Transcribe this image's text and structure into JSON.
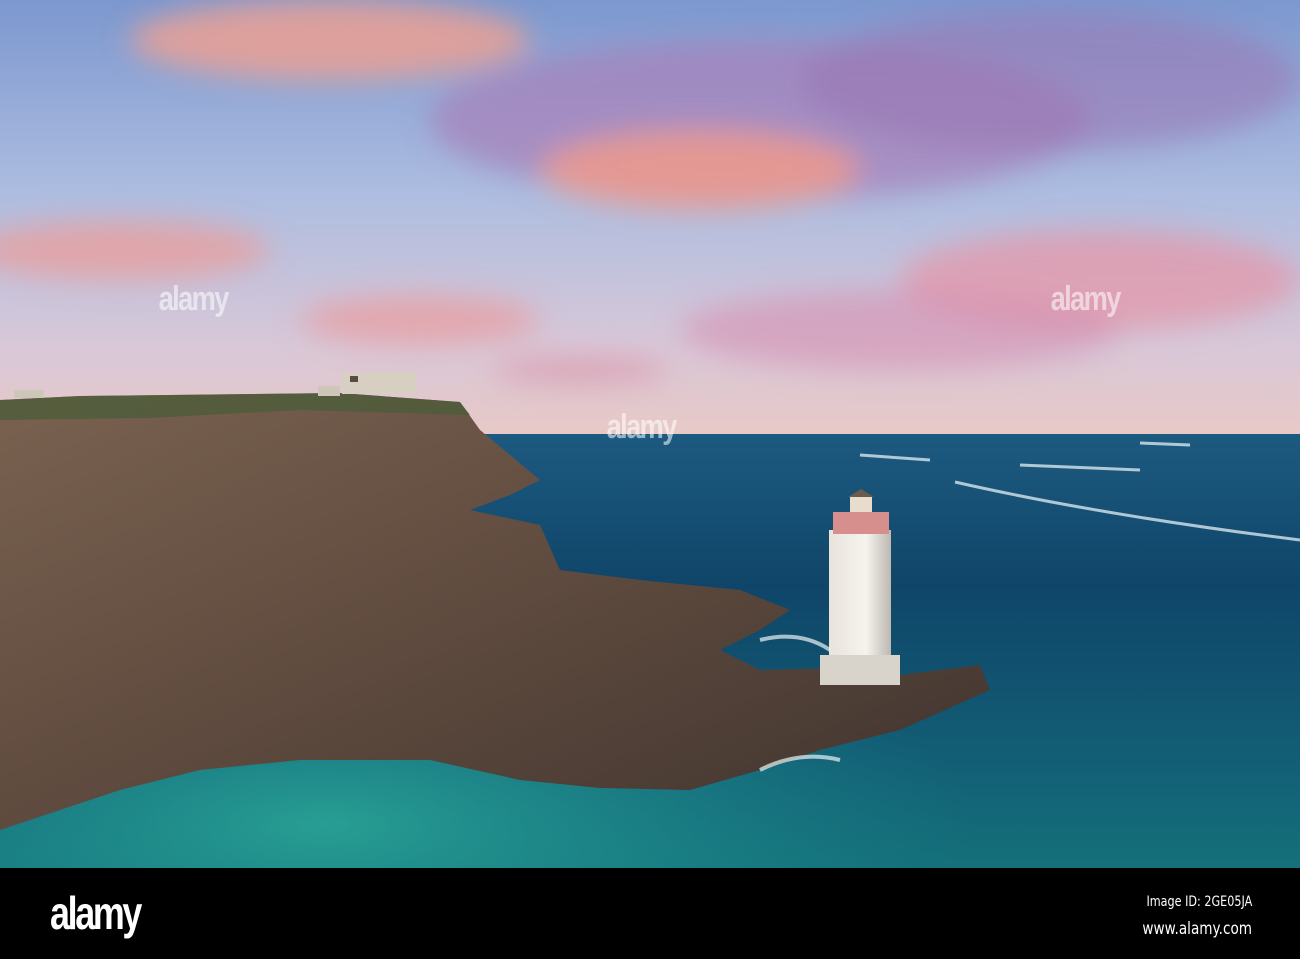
{
  "photo": {
    "subject": "lighthouse-on-rocky-coast",
    "colors": {
      "sky_top": "#7f9fd0",
      "sky_pink": "#f2a0a0",
      "sea_deep": "#0d3f63",
      "sea_teal": "#1a8a8e",
      "rock": "#6b5446"
    }
  },
  "watermark": {
    "text": "alamy"
  },
  "footer": {
    "logo": "alamy",
    "image_id": "Image ID: 2GE05JA",
    "website": "www.alamy.com"
  }
}
